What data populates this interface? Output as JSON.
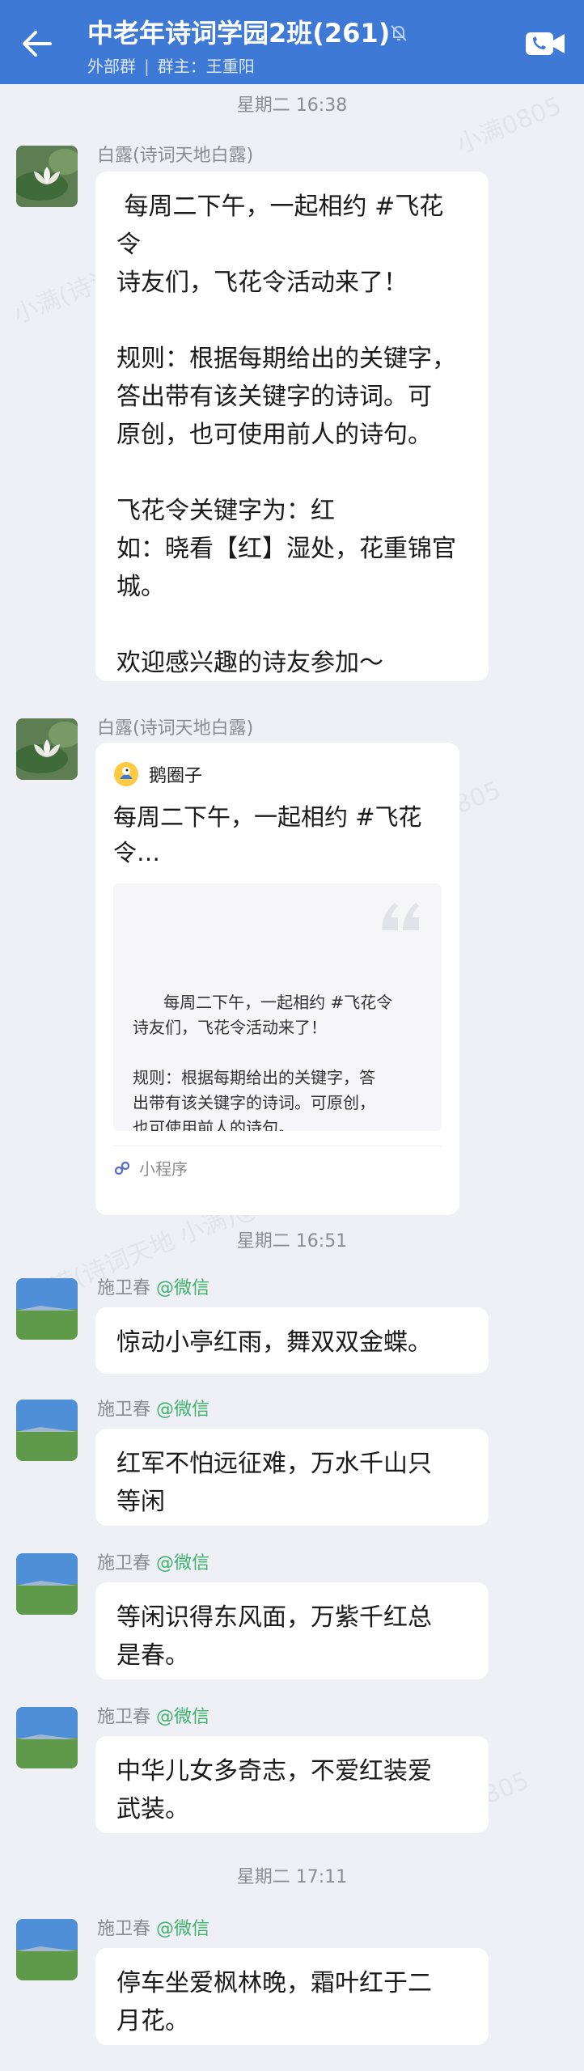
{
  "header": {
    "title": "中老年诗词学园2班(261)",
    "group_type": "外部群",
    "owner": "群主：王重阳"
  },
  "times": [
    "星期二  16:38",
    "星期二  16:51",
    "星期二  17:11"
  ],
  "messages": [
    {
      "sender": "白露(诗词天地白露)",
      "text": " 每周二下午，一起相约 #飞花\n令\n诗友们，飞花令活动来了！\n\n规则：根据每期给出的关键字，\n答出带有该关键字的诗词。可\n原创，也可使用前人的诗句。\n\n飞花令关键字为：红\n如：晓看【红】湿处，花重锦官\n城。\n\n欢迎感兴趣的诗友参加～"
    },
    {
      "sender": "白露(诗词天地白露)",
      "card": {
        "app": "鹅圈子",
        "title": "每周二下午，一起相约 #飞花\n令…",
        "preview": "每周二下午，一起相约 #飞花令\n诗友们，飞花令活动来了！\n\n规则：根据每期给出的关键字，答\n出带有该关键字的诗词。可原创，\n也可使用前人的诗句。\n\n飞花令关键字为：红",
        "footer": "小程序"
      }
    },
    {
      "sender": "施卫春",
      "sender_tag": "@微信",
      "text": "惊动小亭红雨，舞双双金蝶。"
    },
    {
      "sender": "施卫春",
      "sender_tag": "@微信",
      "text": "红军不怕远征难，万水千山只\n等闲"
    },
    {
      "sender": "施卫春",
      "sender_tag": "@微信",
      "text": "等闲识得东风面，万紫千红总\n是春。"
    },
    {
      "sender": "施卫春",
      "sender_tag": "@微信",
      "text": "中华儿女多奇志，不爱红装爱\n武装。"
    },
    {
      "sender": "施卫春",
      "sender_tag": "@微信",
      "text": "停车坐爱枫林晚，霜叶红于二\n月花。"
    }
  ],
  "watermarks": [
    "小满0805",
    "小满(诗词天地",
    "诗词天地 小满0805",
    "小满(诗词天地 小满)@诗词天地",
    "小满0805"
  ],
  "colors": {
    "header": "#3f79d6",
    "background": "#eef0f5",
    "wechat_tag": "#3db26b"
  }
}
